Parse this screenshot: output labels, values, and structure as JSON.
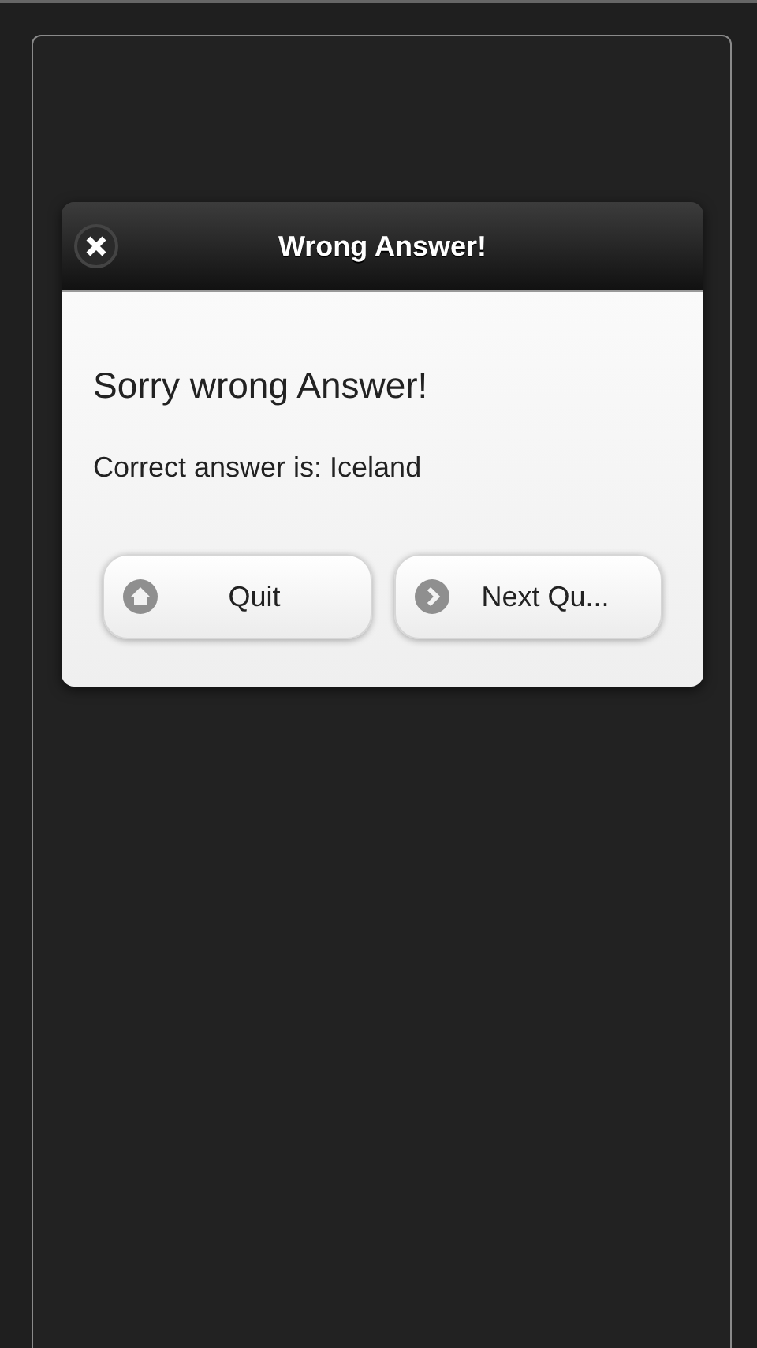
{
  "dialog": {
    "title": "Wrong Answer!",
    "heading": "Sorry wrong Answer!",
    "message": "Correct answer is: Iceland",
    "buttons": [
      {
        "label": "Quit",
        "kind": "home"
      },
      {
        "label": "Next Qu...",
        "kind": "next"
      }
    ]
  }
}
